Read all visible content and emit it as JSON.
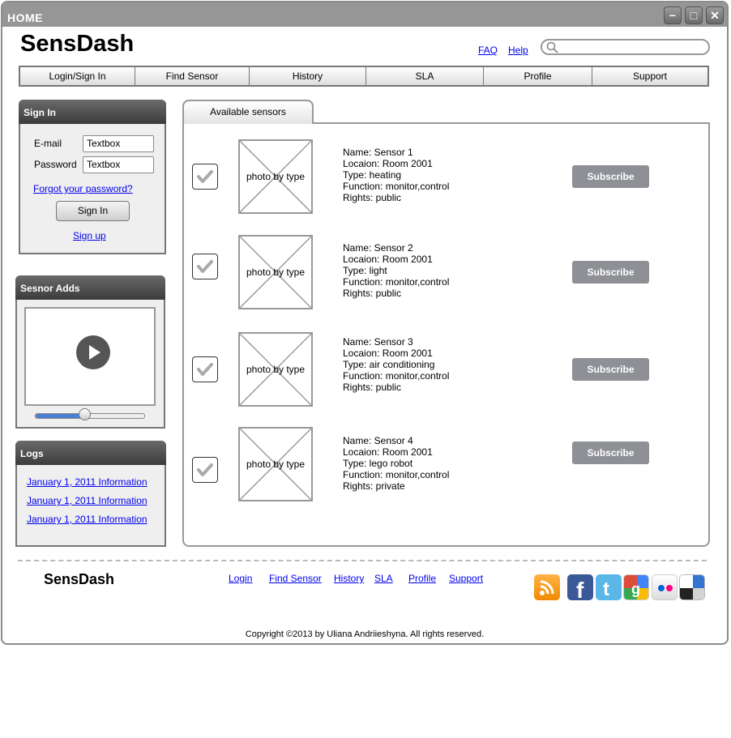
{
  "window": {
    "title": "HOME"
  },
  "header": {
    "brand": "SensDash",
    "links": [
      "FAQ",
      "Help"
    ],
    "search_placeholder": ""
  },
  "nav": {
    "items": [
      "Login/Sign In",
      "Find Sensor",
      "History",
      "SLA",
      "Profile",
      "Support"
    ]
  },
  "signin": {
    "title": "Sign In",
    "email_label": "E-mail",
    "email_value": "Textbox",
    "password_label": "Password",
    "password_value": "Textbox",
    "forgot": "Forgot your password?",
    "button": "Sign In",
    "signup": "Sign up"
  },
  "ads": {
    "title": "Sesnor Adds",
    "progress": 0.45
  },
  "logs": {
    "title": "Logs",
    "items": [
      "January 1, 2011  Information",
      "January 1, 2011  Information",
      "January 1, 2011  Information"
    ]
  },
  "sensors": {
    "tab": "Available sensors",
    "photo_label": "photo by type",
    "subscribe": "Subscribe",
    "items": [
      {
        "name": "Name: Sensor 1",
        "location": "Locaion: Room 2001",
        "type": "Type: heating",
        "function": "Function: monitor,control",
        "rights": "Rights: public"
      },
      {
        "name": "Name: Sensor 2",
        "location": "Locaion: Room 2001",
        "type": "Type: light",
        "function": "Function: monitor,control",
        "rights": "Rights: public"
      },
      {
        "name": "Name: Sensor 3",
        "location": "Locaion: Room 2001",
        "type": "Type: air conditioning",
        "function": "Function: monitor,control",
        "rights": "Rights: public"
      },
      {
        "name": "Name: Sensor 4",
        "location": "Locaion: Room 2001",
        "type": "Type: lego robot",
        "function": "Function: monitor,control",
        "rights": "Rights: private"
      }
    ]
  },
  "footer": {
    "brand": "SensDash",
    "links": [
      "Login",
      "Find Sensor",
      "History",
      "SLA",
      "Profile",
      "Support"
    ],
    "social": [
      "rss-icon",
      "facebook-icon",
      "twitter-icon",
      "google-icon",
      "flickr-icon",
      "delicious-icon"
    ],
    "copyright": "Copyright ©2013 by Uliana Andriieshyna. All rights reserved."
  },
  "colors": {
    "accent": "#0000ee",
    "button": "#8e9096",
    "progress": "#4a7fd4"
  }
}
